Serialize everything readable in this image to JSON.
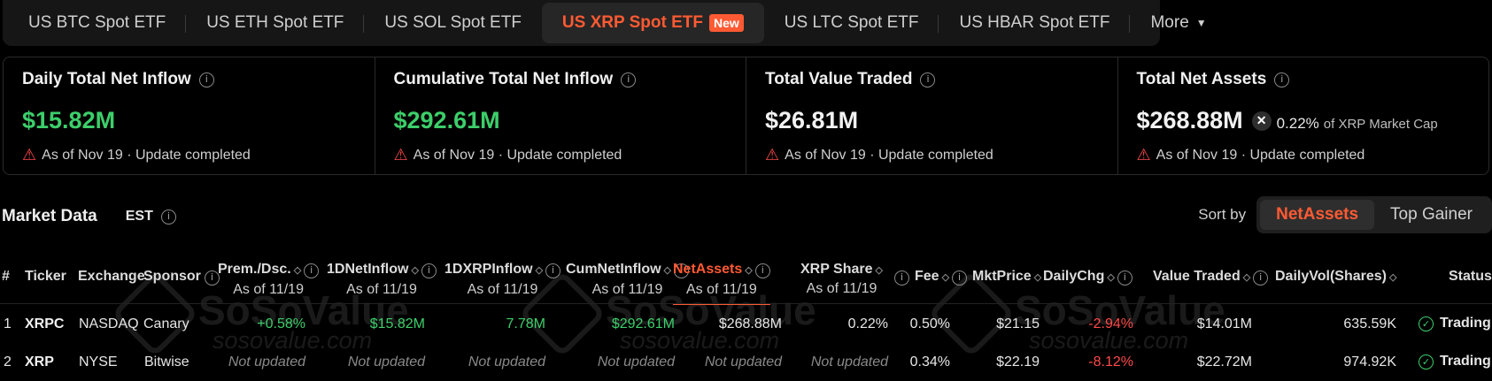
{
  "tabs": [
    {
      "label": "US BTC Spot ETF"
    },
    {
      "label": "US ETH Spot ETF"
    },
    {
      "label": "US SOL Spot ETF"
    },
    {
      "label": "US XRP Spot ETF",
      "badge": "New",
      "active": true
    },
    {
      "label": "US LTC Spot ETF"
    },
    {
      "label": "US HBAR Spot ETF"
    },
    {
      "label": "More"
    }
  ],
  "stats": [
    {
      "label": "Daily Total Net Inflow",
      "value": "$15.82M",
      "foot_date": "As of Nov 19",
      "foot_status": "Update completed"
    },
    {
      "label": "Cumulative Total Net Inflow",
      "value": "$292.61M",
      "foot_date": "As of Nov 19",
      "foot_status": "Update completed"
    },
    {
      "label": "Total Value Traded",
      "value": "$26.81M",
      "foot_date": "As of Nov 19",
      "foot_status": "Update completed"
    },
    {
      "label": "Total Net Assets",
      "value": "$268.88M",
      "pct": "0.22%",
      "pct_label": "of XRP Market Cap",
      "foot_date": "As of Nov 19",
      "foot_status": "Update completed"
    }
  ],
  "market": {
    "title": "Market Data",
    "timezone": "EST",
    "sort_label": "Sort by",
    "sort_options": [
      "NetAssets",
      "Top Gainer"
    ]
  },
  "watermark": {
    "brand": "SoSoValue",
    "site": "sosovalue.com"
  },
  "columns": {
    "num": "#",
    "ticker": "Ticker",
    "exchange": "Exchange",
    "sponsor": "Sponsor",
    "prem": "Prem./Dsc.",
    "dnet": "1DNetInflow",
    "dxrp": "1DXRPInflow",
    "cum": "CumNetInflow",
    "net": "NetAssets",
    "share": "XRP Share",
    "fee": "Fee",
    "mkt": "MktPrice",
    "chg": "DailyChg",
    "val": "Value Traded",
    "vol": "DailyVol(Shares)",
    "status": "Status",
    "asof": "As of 11/19"
  },
  "rows": [
    {
      "num": "1",
      "ticker": "XRPC",
      "exchange": "NASDAQ",
      "sponsor": "Canary",
      "prem": "+0.58%",
      "dnet": "$15.82M",
      "dxrp": "7.78M",
      "cum": "$292.61M",
      "net": "$268.88M",
      "share": "0.22%",
      "fee": "0.50%",
      "mkt": "$21.15",
      "chg": "-2.94%",
      "val": "$14.01M",
      "vol": "635.59K",
      "status": "Trading"
    },
    {
      "num": "2",
      "ticker": "XRP",
      "exchange": "NYSE",
      "sponsor": "Bitwise",
      "prem": "Not updated",
      "dnet": "Not updated",
      "dxrp": "Not updated",
      "cum": "Not updated",
      "net": "Not updated",
      "share": "Not updated",
      "fee": "0.34%",
      "mkt": "$22.19",
      "chg": "-8.12%",
      "val": "$22.72M",
      "vol": "974.92K",
      "status": "Trading"
    }
  ]
}
